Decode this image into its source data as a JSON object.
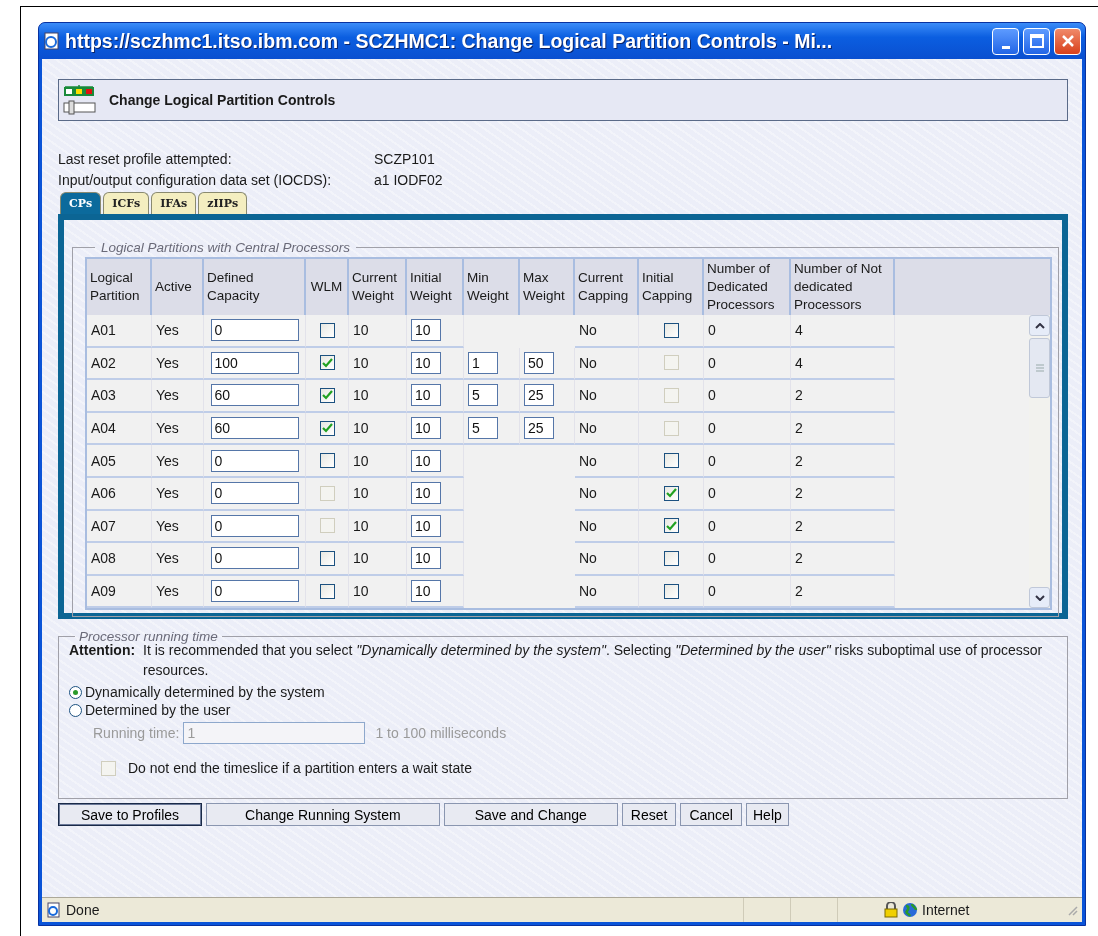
{
  "window": {
    "title": "https://sczhmc1.itso.ibm.com - SCZHMC1: Change Logical Partition Controls - Mi..."
  },
  "header": {
    "title": "Change Logical Partition Controls"
  },
  "info": [
    {
      "label": "Last reset profile attempted:",
      "value": "SCZP101"
    },
    {
      "label": "Input/output configuration data set (IOCDS):",
      "value": "a1 IODF02"
    }
  ],
  "tabs": [
    {
      "label": "CPs",
      "selected": true
    },
    {
      "label": "ICFs",
      "selected": false
    },
    {
      "label": "IFAs",
      "selected": false
    },
    {
      "label": "zIIPs",
      "selected": false
    }
  ],
  "table": {
    "legend": "Logical Partitions with Central Processors",
    "columns": [
      "Logical Partition",
      "Active",
      "Defined Capacity",
      "WLM",
      "Current Weight",
      "Initial Weight",
      "Min Weight",
      "Max Weight",
      "Current Capping",
      "Initial Capping",
      "Number of Dedicated Processors",
      "Number of Not dedicated Processors"
    ],
    "rows": [
      {
        "partition": "A01",
        "active": "Yes",
        "defined_capacity": "0",
        "wlm": {
          "checked": false,
          "disabled": false
        },
        "current_weight": "10",
        "initial_weight": "10",
        "current_capping": "No",
        "initial_capping": {
          "checked": false,
          "disabled": false
        },
        "dedicated": "0",
        "not_dedicated": "4"
      },
      {
        "partition": "A02",
        "active": "Yes",
        "defined_capacity": "100",
        "wlm": {
          "checked": true,
          "disabled": false
        },
        "current_weight": "10",
        "initial_weight": "10",
        "min_weight": "1",
        "max_weight": "50",
        "current_capping": "No",
        "initial_capping": {
          "checked": false,
          "disabled": true
        },
        "dedicated": "0",
        "not_dedicated": "4"
      },
      {
        "partition": "A03",
        "active": "Yes",
        "defined_capacity": "60",
        "wlm": {
          "checked": true,
          "disabled": false
        },
        "current_weight": "10",
        "initial_weight": "10",
        "min_weight": "5",
        "max_weight": "25",
        "current_capping": "No",
        "initial_capping": {
          "checked": false,
          "disabled": true
        },
        "dedicated": "0",
        "not_dedicated": "2"
      },
      {
        "partition": "A04",
        "active": "Yes",
        "defined_capacity": "60",
        "wlm": {
          "checked": true,
          "disabled": false
        },
        "current_weight": "10",
        "initial_weight": "10",
        "min_weight": "5",
        "max_weight": "25",
        "current_capping": "No",
        "initial_capping": {
          "checked": false,
          "disabled": true
        },
        "dedicated": "0",
        "not_dedicated": "2"
      },
      {
        "partition": "A05",
        "active": "Yes",
        "defined_capacity": "0",
        "wlm": {
          "checked": false,
          "disabled": false
        },
        "current_weight": "10",
        "initial_weight": "10",
        "current_capping": "No",
        "initial_capping": {
          "checked": false,
          "disabled": false
        },
        "dedicated": "0",
        "not_dedicated": "2"
      },
      {
        "partition": "A06",
        "active": "Yes",
        "defined_capacity": "0",
        "wlm": {
          "checked": false,
          "disabled": true
        },
        "current_weight": "10",
        "initial_weight": "10",
        "current_capping": "No",
        "initial_capping": {
          "checked": true,
          "disabled": false
        },
        "dedicated": "0",
        "not_dedicated": "2"
      },
      {
        "partition": "A07",
        "active": "Yes",
        "defined_capacity": "0",
        "wlm": {
          "checked": false,
          "disabled": true
        },
        "current_weight": "10",
        "initial_weight": "10",
        "current_capping": "No",
        "initial_capping": {
          "checked": true,
          "disabled": false
        },
        "dedicated": "0",
        "not_dedicated": "2"
      },
      {
        "partition": "A08",
        "active": "Yes",
        "defined_capacity": "0",
        "wlm": {
          "checked": false,
          "disabled": false
        },
        "current_weight": "10",
        "initial_weight": "10",
        "current_capping": "No",
        "initial_capping": {
          "checked": false,
          "disabled": false
        },
        "dedicated": "0",
        "not_dedicated": "2"
      },
      {
        "partition": "A09",
        "active": "Yes",
        "defined_capacity": "0",
        "wlm": {
          "checked": false,
          "disabled": false
        },
        "current_weight": "10",
        "initial_weight": "10",
        "current_capping": "No",
        "initial_capping": {
          "checked": false,
          "disabled": false
        },
        "dedicated": "0",
        "not_dedicated": "2"
      }
    ]
  },
  "running_time": {
    "legend": "Processor running time",
    "attention_label": "Attention:",
    "attention_text": "It is recommended that you select *\"Dynamically determined by the system\"*. Selecting *\"Determined by the user\"* risks suboptimal use of processor resources.",
    "options": [
      {
        "label": "Dynamically determined by the system",
        "selected": true
      },
      {
        "label": "Determined by the user",
        "selected": false
      }
    ],
    "field_label": "Running time:",
    "field_value": "1",
    "field_disabled": true,
    "field_hint": "1 to 100 milliseconds",
    "timeslice": {
      "label": "Do not end the timeslice if a partition enters a wait state",
      "checked": false,
      "disabled": true
    }
  },
  "buttons": [
    {
      "label": "Save to Profiles",
      "default": true
    },
    {
      "label": "Change Running System",
      "default": false
    },
    {
      "label": "Save and Change",
      "default": false
    },
    {
      "label": "Reset",
      "default": false
    },
    {
      "label": "Cancel",
      "default": false
    },
    {
      "label": "Help",
      "default": false
    }
  ],
  "status_bar": {
    "text": "Done",
    "zone": "Internet"
  }
}
